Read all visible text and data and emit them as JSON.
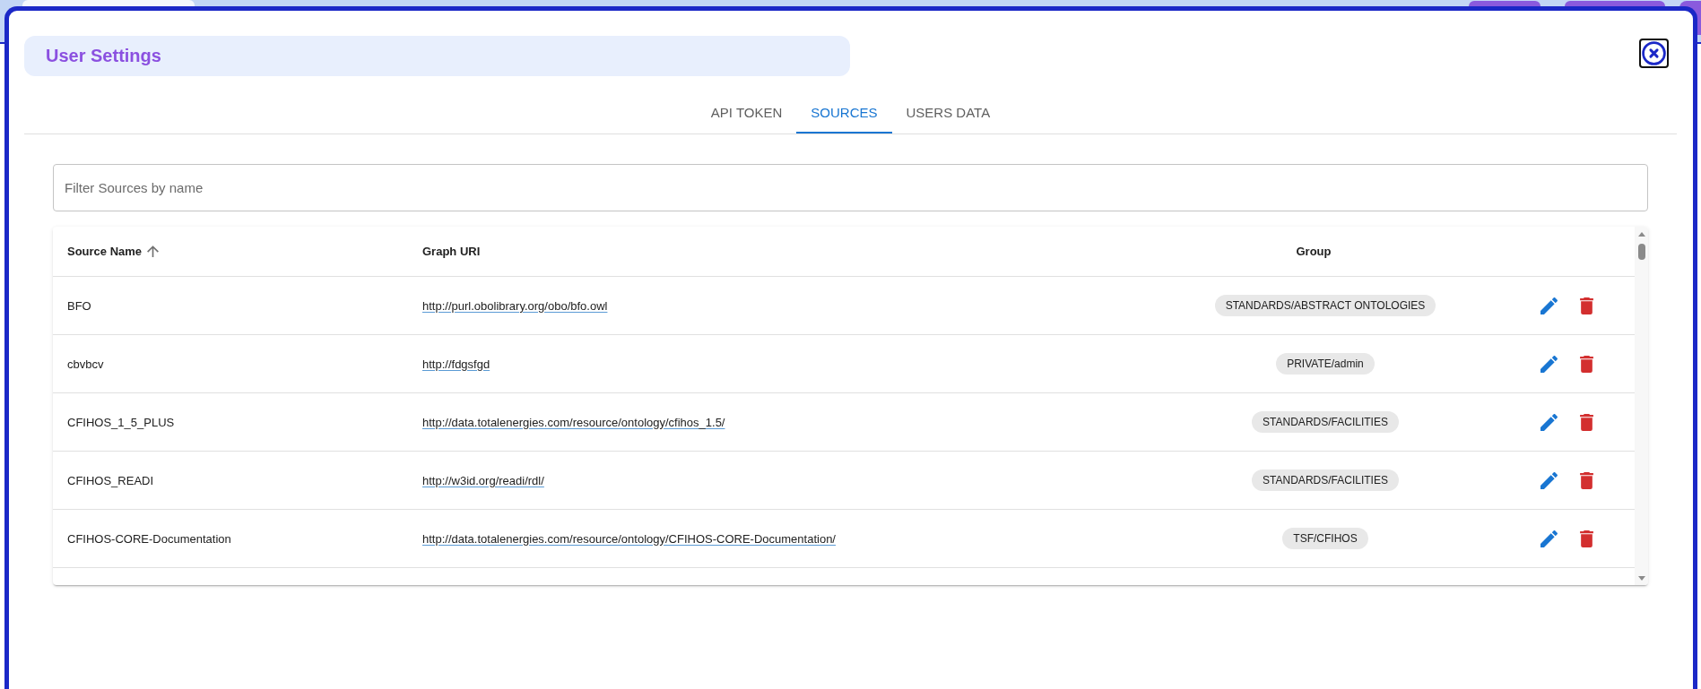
{
  "dialog": {
    "title": "User Settings"
  },
  "tabs": [
    {
      "label": "API TOKEN",
      "selected": false
    },
    {
      "label": "SOURCES",
      "selected": true
    },
    {
      "label": "USERS DATA",
      "selected": false
    }
  ],
  "filter": {
    "placeholder": "Filter Sources by name"
  },
  "table": {
    "columns": [
      {
        "label": "Source Name",
        "sort_ascending": true
      },
      {
        "label": "Graph URI"
      },
      {
        "label": "Group"
      }
    ],
    "rows": [
      {
        "source_name": "BFO",
        "graph_uri": "http://purl.obolibrary.org/obo/bfo.owl",
        "group": "STANDARDS/ABSTRACT ONTOLOGIES"
      },
      {
        "source_name": "cbvbcv",
        "graph_uri": "http://fdgsfgd",
        "group": "PRIVATE/admin"
      },
      {
        "source_name": "CFIHOS_1_5_PLUS",
        "graph_uri": "http://data.totalenergies.com/resource/ontology/cfihos_1.5/",
        "group": "STANDARDS/FACILITIES"
      },
      {
        "source_name": "CFIHOS_READI",
        "graph_uri": "http://w3id.org/readi/rdl/",
        "group": "STANDARDS/FACILITIES"
      },
      {
        "source_name": "CFIHOS-CORE-Documentation",
        "graph_uri": "http://data.totalenergies.com/resource/ontology/CFIHOS-CORE-Documentation/",
        "group": "TSF/CFIHOS"
      }
    ]
  }
}
